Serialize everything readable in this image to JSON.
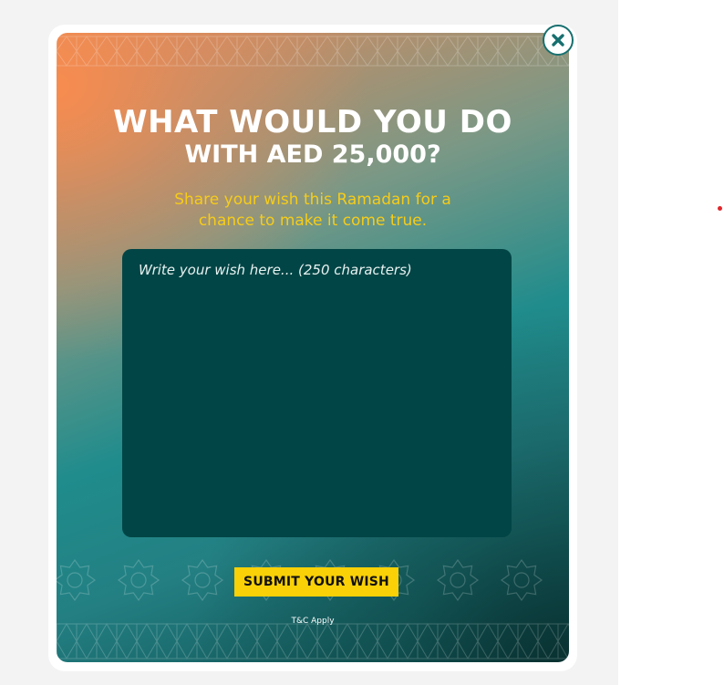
{
  "modal": {
    "headline_line1": "WHAT WOULD YOU DO",
    "headline_line2": "WITH AED 25,000?",
    "subtitle_line1": "Share your wish this Ramadan for a",
    "subtitle_line2": "chance to make it come true.",
    "wish_field": {
      "placeholder": "Write your wish here... (250 characters)",
      "value": ""
    },
    "submit_label": "SUBMIT YOUR WISH",
    "terms_label": "T&C Apply",
    "close_icon": "close-icon"
  },
  "colors": {
    "headline": "#ffffff",
    "subtitle": "#f6cc1a",
    "textarea_bg": "#024546",
    "button_bg": "#fad106",
    "close_ring": "#17706f",
    "gradient_orange": "#e0895a",
    "gradient_teal": "#208c8c",
    "gradient_dark": "#0d4a4b"
  }
}
